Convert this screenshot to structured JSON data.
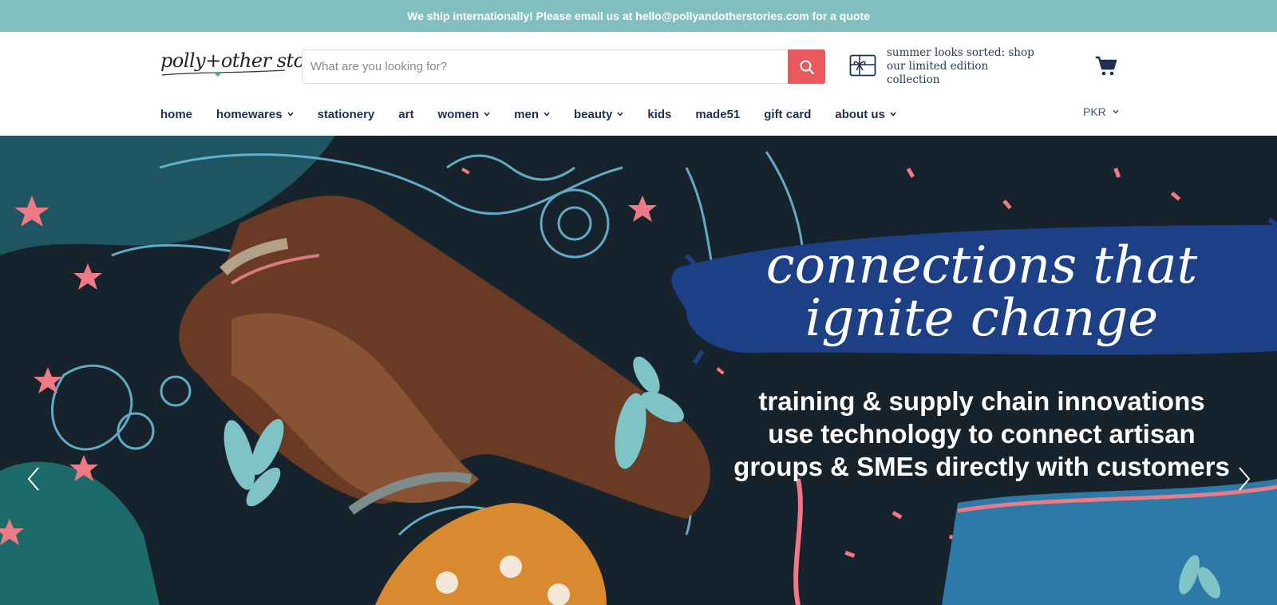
{
  "announcement": "We ship internationally! Please email us at hello@pollyandotherstories.com for a quote",
  "logo": {
    "text": "polly+other stories"
  },
  "search": {
    "placeholder": "What are you looking for?"
  },
  "promo": {
    "text": "summer looks sorted: shop our limited edition collection"
  },
  "nav": {
    "items": [
      {
        "label": "home",
        "dropdown": false
      },
      {
        "label": "homewares",
        "dropdown": true
      },
      {
        "label": "stationery",
        "dropdown": false
      },
      {
        "label": "art",
        "dropdown": false
      },
      {
        "label": "women",
        "dropdown": true
      },
      {
        "label": "men",
        "dropdown": true
      },
      {
        "label": "beauty",
        "dropdown": true
      },
      {
        "label": "kids",
        "dropdown": false
      },
      {
        "label": "made51",
        "dropdown": false
      },
      {
        "label": "gift card",
        "dropdown": false
      },
      {
        "label": "about us",
        "dropdown": true
      }
    ]
  },
  "currency": "PKR",
  "hero": {
    "headline_line1": "connections that",
    "headline_line2": "ignite change",
    "subline_line1": "training & supply chain innovations",
    "subline_line2": "use technology to connect artisan",
    "subline_line3": "groups & SMEs directly with customers"
  },
  "colors": {
    "announcement_bg": "#82bfc1",
    "accent": "#e9595b",
    "nav_text": "#1e2f52",
    "brush": "#1d3f86"
  },
  "icons": {
    "search": "search-icon",
    "cart": "cart-icon",
    "promo": "gift-card-icon",
    "prev": "chevron-left-icon",
    "next": "chevron-right-icon"
  }
}
